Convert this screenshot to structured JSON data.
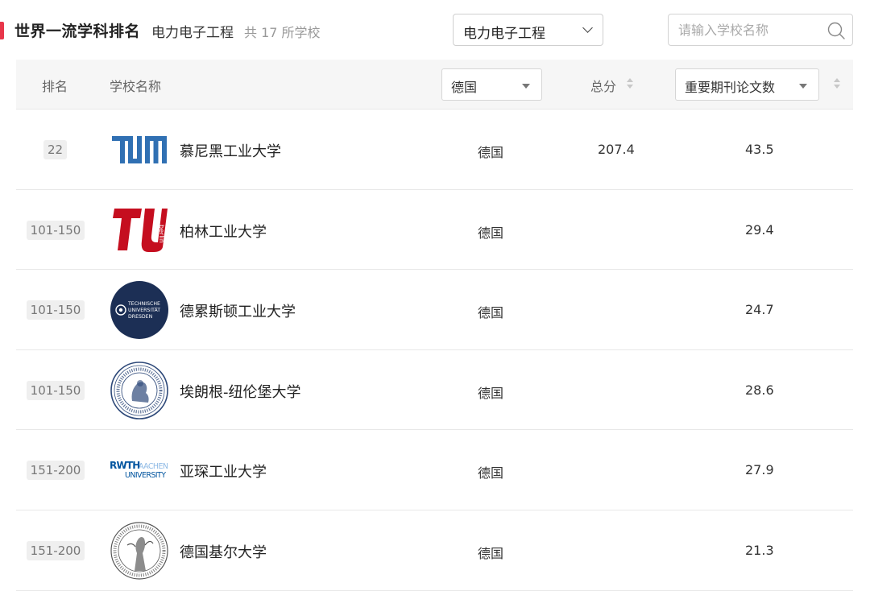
{
  "header": {
    "title": "世界一流学科排名",
    "subject": "电力电子工程",
    "count_text": "共 17 所学校"
  },
  "subject_select": {
    "value": "电力电子工程"
  },
  "search": {
    "placeholder": "请输入学校名称"
  },
  "table": {
    "columns": {
      "rank": "排名",
      "name": "学校名称",
      "country_filter": "德国",
      "total": "总分",
      "metric_filter": "重要期刊论文数"
    },
    "rows": [
      {
        "rank": "22",
        "name": "慕尼黑工业大学",
        "country": "德国",
        "total": "207.4",
        "metric": "43.5",
        "logo": "tum-logo"
      },
      {
        "rank": "101-150",
        "name": "柏林工业大学",
        "country": "德国",
        "total": "",
        "metric": "29.4",
        "logo": "tu-berlin-logo"
      },
      {
        "rank": "101-150",
        "name": "德累斯顿工业大学",
        "country": "德国",
        "total": "",
        "metric": "24.7",
        "logo": "tu-dresden-logo"
      },
      {
        "rank": "101-150",
        "name": "埃朗根-纽伦堡大学",
        "country": "德国",
        "total": "",
        "metric": "28.6",
        "logo": "fau-seal-logo"
      },
      {
        "rank": "151-200",
        "name": "亚琛工业大学",
        "country": "德国",
        "total": "",
        "metric": "27.9",
        "logo": "rwth-logo"
      },
      {
        "rank": "151-200",
        "name": "德国基尔大学",
        "country": "德国",
        "total": "",
        "metric": "21.3",
        "logo": "kiel-seal-logo"
      }
    ],
    "logo_text": {
      "tum": "TUM",
      "berlin": "berlin",
      "dresden": [
        "TECHNISCHE",
        "UNIVERSITÄT",
        "DRESDEN"
      ],
      "rwth_1": "RWTH",
      "rwth_2": "AACHEN",
      "rwth_3": "UNIVERSITY"
    }
  },
  "colors": {
    "accent": "#e8364a",
    "tum_blue": "#3070b3",
    "tu_berlin_red": "#c50e1f",
    "dresden_navy": "#1c2f55",
    "rwth_blue": "#00549f",
    "rwth_light": "#8ebae5",
    "seal_blue": "#2f4a7a"
  }
}
